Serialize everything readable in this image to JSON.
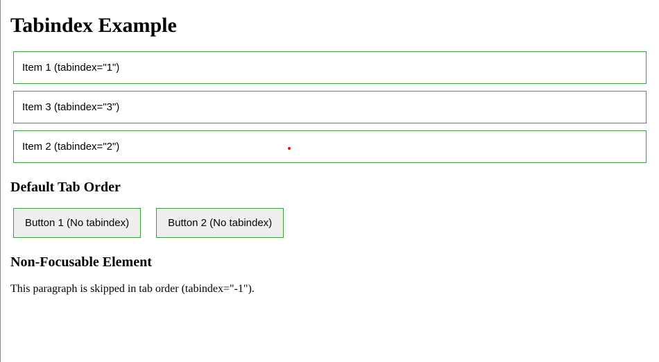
{
  "heading": "Tabindex Example",
  "items": [
    {
      "label": "Item 1 (tabindex=\"1\")"
    },
    {
      "label": "Item 3 (tabindex=\"3\")"
    },
    {
      "label": "Item 2 (tabindex=\"2\")"
    }
  ],
  "subheading1": "Default Tab Order",
  "buttons": [
    {
      "label": "Button 1 (No tabindex)"
    },
    {
      "label": "Button 2 (No tabindex)"
    }
  ],
  "subheading2": "Non-Focusable Element",
  "paragraph": "This paragraph is skipped in tab order (tabindex=\"-1\")."
}
